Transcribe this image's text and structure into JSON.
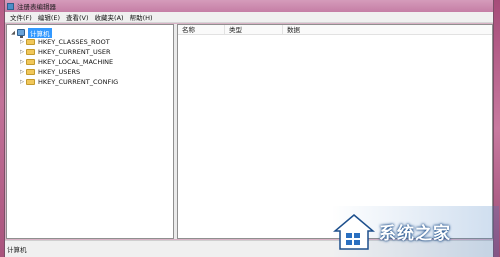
{
  "window": {
    "title": "注册表编辑器"
  },
  "menu": {
    "items": [
      {
        "label": "文件(F)"
      },
      {
        "label": "编辑(E)"
      },
      {
        "label": "查看(V)"
      },
      {
        "label": "收藏夹(A)"
      },
      {
        "label": "帮助(H)"
      }
    ]
  },
  "tree": {
    "root": {
      "label": "计算机",
      "icon": "computer-icon",
      "expander": "◢"
    },
    "children": [
      {
        "label": "HKEY_CLASSES_ROOT",
        "icon": "folder-icon",
        "expander": "▷"
      },
      {
        "label": "HKEY_CURRENT_USER",
        "icon": "folder-icon",
        "expander": "▷"
      },
      {
        "label": "HKEY_LOCAL_MACHINE",
        "icon": "folder-icon",
        "expander": "▷"
      },
      {
        "label": "HKEY_USERS",
        "icon": "folder-icon",
        "expander": "▷"
      },
      {
        "label": "HKEY_CURRENT_CONFIG",
        "icon": "folder-icon",
        "expander": "▷"
      }
    ]
  },
  "list": {
    "columns": [
      {
        "label": "名称"
      },
      {
        "label": "类型"
      },
      {
        "label": "数据"
      }
    ]
  },
  "status": {
    "text": "计算机"
  },
  "watermark": {
    "text": "系统之家"
  },
  "colors": {
    "selection": "#3399ff",
    "folder": "#f0c75a",
    "desktop": "#c46b8e"
  }
}
